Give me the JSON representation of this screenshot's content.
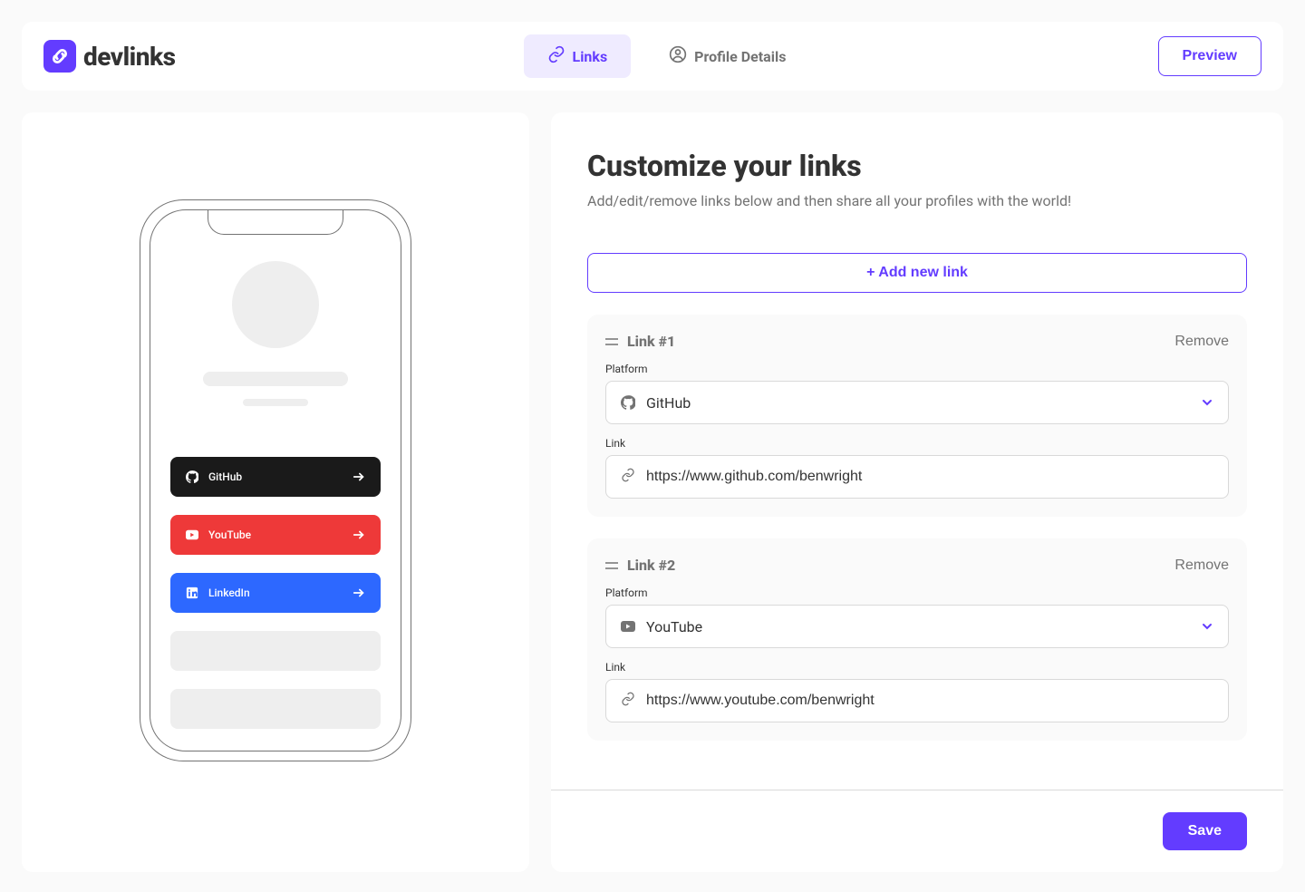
{
  "brand": {
    "name": "devlinks"
  },
  "tabs": {
    "links": "Links",
    "profile": "Profile Details"
  },
  "preview_button": "Preview",
  "editor": {
    "title": "Customize your links",
    "subtitle": "Add/edit/remove links below and then share all your profiles with the world!",
    "add_button": "+ Add new link",
    "platform_label": "Platform",
    "link_label": "Link",
    "remove_label": "Remove",
    "link_prefix": "Link #",
    "save_button": "Save"
  },
  "preview_links": [
    {
      "platform": "GitHub",
      "color": "#1a1a1a"
    },
    {
      "platform": "YouTube",
      "color": "#ee3939"
    },
    {
      "platform": "LinkedIn",
      "color": "#2d68ff"
    }
  ],
  "links": [
    {
      "num": "1",
      "platform": "GitHub",
      "url": "https://www.github.com/benwright"
    },
    {
      "num": "2",
      "platform": "YouTube",
      "url": "https://www.youtube.com/benwright"
    }
  ]
}
